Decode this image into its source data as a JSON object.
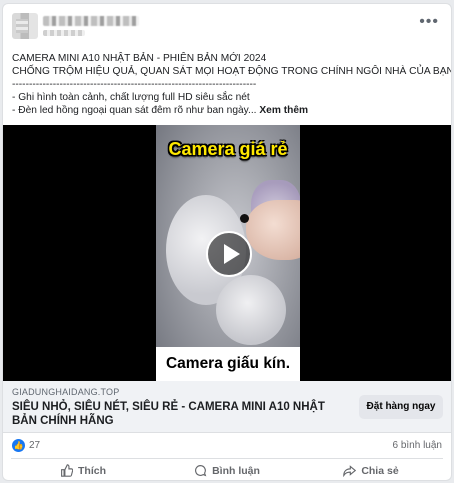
{
  "post": {
    "text_lines": [
      "CAMERA MINI A10 NHẬT BẢN - PHIÊN BẢN MỚI 2024",
      "CHỐNG TRỘM HIỆU QUẢ, QUAN SÁT MỌI HOẠT ĐỘNG TRONG CHÍNH NGÔI NHÀ CỦA BẠN",
      "------------------------------------------------------------------------",
      "- Ghi hình toàn cảnh, chất lượng full HD siêu sắc nét",
      "- Đèn led hồng ngoại quan sát đêm rõ như ban ngày..."
    ],
    "see_more": "Xem thêm",
    "more_options_icon": "more-horizontal-icon"
  },
  "media": {
    "top_caption": "Camera giá rẻ",
    "bottom_caption": "Camera giấu kín.",
    "play_icon": "play-icon"
  },
  "link_preview": {
    "domain": "GIADUNGHAIDANG.TOP",
    "title": "SIÊU NHỎ, SIÊU NÉT, SIÊU RẺ - CAMERA MINI A10 NHẬT BẢN CHÍNH HÃNG",
    "cta_label": "Đặt hàng ngay"
  },
  "stats": {
    "likes": "27",
    "comments": "6 bình luận"
  },
  "actions": {
    "like": "Thích",
    "comment": "Bình luận",
    "share": "Chia sẻ"
  },
  "colors": {
    "accent": "#1877f2",
    "caption_yellow": "#ffe800"
  }
}
